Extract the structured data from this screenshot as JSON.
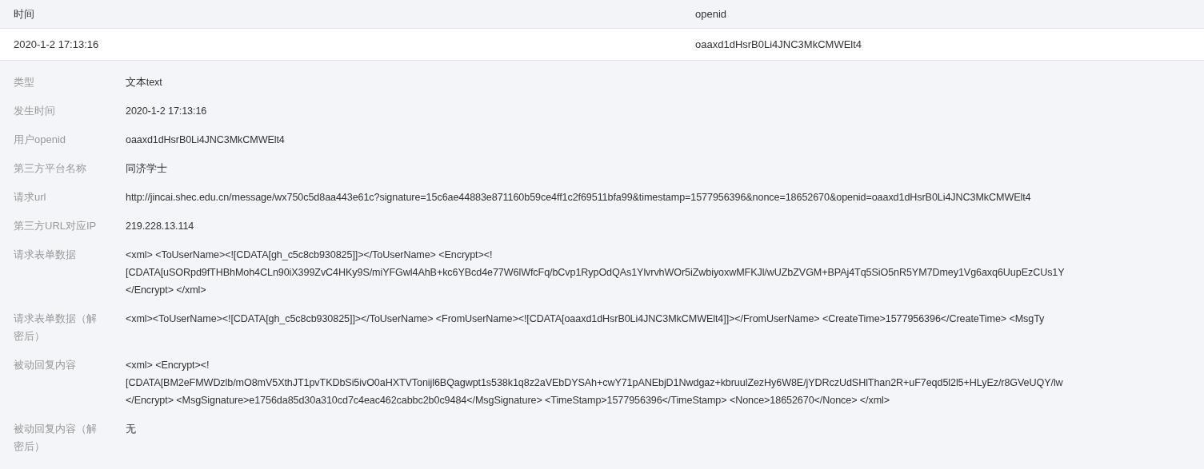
{
  "table": {
    "columns": [
      "时间",
      "openid"
    ],
    "rows": [
      {
        "cells": [
          "2020-1-2 17:13:16",
          "oaaxd1dHsrB0Li4JNC3MkCMWElt4"
        ]
      }
    ]
  },
  "details": [
    {
      "label": "类型",
      "value": "文本text"
    },
    {
      "label": "发生时间",
      "value": "2020-1-2 17:13:16"
    },
    {
      "label": "用户openid",
      "value": "oaaxd1dHsrB0Li4JNC3MkCMWElt4"
    },
    {
      "label": "第三方平台名称",
      "value": "同济学士"
    },
    {
      "label": "请求url",
      "value": "http://jincai.shec.edu.cn/message/wx750c5d8aa443e61c?signature=15c6ae44883e871160b59ce4ff1c2f69511bfa99&timestamp=1577956396&nonce=18652670&openid=oaaxd1dHsrB0Li4JNC3MkCMWElt4"
    },
    {
      "label": "第三方URL对应IP",
      "value": "219.228.13.114"
    },
    {
      "label": "请求表单数据",
      "value": "<xml> <ToUserName><![CDATA[gh_c5c8cb930825]]></ToUserName> <Encrypt><!\n[CDATA[uSORpd9fTHBhMoh4CLn90iX399ZvC4HKy9S/miYFGwl4AhB+kc6YBcd4e77W6lWfcFq/bCvp1RypOdQAs1YlvrvhWOr5iZwbiyoxwMFKJl/wUZbZVGM+BPAj4Tq5SiO5nR5YM7Dmey1Vg6axq6UupEzCUs1Y\n</Encrypt> </xml>"
    },
    {
      "label": "请求表单数据（解密后）",
      "value": "<xml><ToUserName><![CDATA[gh_c5c8cb930825]]></ToUserName> <FromUserName><![CDATA[oaaxd1dHsrB0Li4JNC3MkCMWElt4]]></FromUserName> <CreateTime>1577956396</CreateTime> <MsgTy"
    },
    {
      "label": "被动回复内容",
      "value": "<xml> <Encrypt><!\n[CDATA[BM2eFMWDzlb/mO8mV5XthJT1pvTKDbSi5ivO0aHXTVTonijl6BQagwpt1s538k1q8z2aVEbDYSAh+cwY71pANEbjD1Nwdgaz+kbruulZezHy6W8E/jYDRczUdSHlThan2R+uF7eqd5l2l5+HLyEz/r8GVeUQY/lw\n</Encrypt> <MsgSignature>e1756da85d30a310cd7c4eac462cabbc2b0c9484</MsgSignature> <TimeStamp>1577956396</TimeStamp> <Nonce>18652670</Nonce> </xml>"
    },
    {
      "label": "被动回复内容（解密后）",
      "value": "无"
    }
  ]
}
